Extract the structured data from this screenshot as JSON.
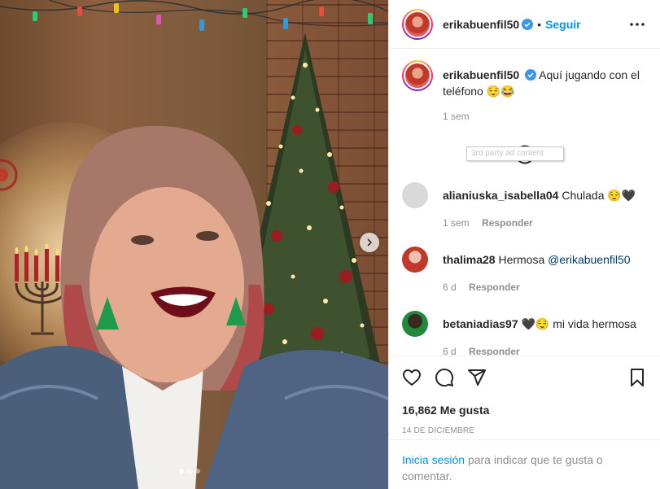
{
  "post": {
    "username": "erikabuenfil50",
    "follow_label": "Seguir",
    "separator": "•"
  },
  "caption": {
    "username": "erikabuenfil50",
    "text": "Aquí jugando con el teléfono 😌😂",
    "time": "1 sem",
    "tooltip": "3rd party ad content"
  },
  "comments": [
    {
      "username": "alianiuska_isabella04",
      "text": "Chulada 😌🖤",
      "time": "1 sem",
      "reply": "Responder",
      "avatar_color": "#d9d9d9"
    },
    {
      "username": "thalima28",
      "text": "Hermosa",
      "mention": "@erikabuenfil50",
      "time": "6 d",
      "reply": "Responder",
      "avatar_color": "#c0392b"
    },
    {
      "username": "betaniadias97",
      "text": "🖤😌 mi vida hermosa",
      "time": "6 d",
      "reply": "Responder",
      "avatar_color": "#1e8a3a"
    }
  ],
  "stats": {
    "likes": "16,862 Me gusta",
    "date": "14 DE DICIEMBRE"
  },
  "login": {
    "link": "Inicia sesión",
    "text": "para indicar que te gusta o comentar."
  },
  "colors": {
    "accent": "#0095f6",
    "muted": "#8e8e8e",
    "text": "#262626"
  },
  "icons": [
    "verified-badge-icon",
    "more-options-icon",
    "load-more-comments-icon",
    "heart-icon",
    "comment-icon",
    "share-icon",
    "bookmark-icon",
    "carousel-next-icon"
  ],
  "carousel": {
    "slides": 3,
    "current": 1
  }
}
